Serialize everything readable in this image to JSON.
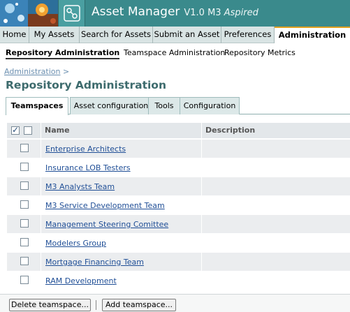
{
  "header": {
    "app_name": "Asset Manager",
    "version_prefix": "V1.0 M3",
    "version_suffix": "Aspired",
    "colors": {
      "bar": "#3a8a8c",
      "accent": "#e0a020"
    }
  },
  "main_nav": [
    {
      "label": "Home",
      "active": false
    },
    {
      "label": "My Assets",
      "active": false
    },
    {
      "label": "Search for Assets",
      "active": false
    },
    {
      "label": "Submit an Asset",
      "active": false
    },
    {
      "label": "Preferences",
      "active": false
    },
    {
      "label": "Administration",
      "active": true
    }
  ],
  "sub_nav": [
    {
      "label": "Repository Administration",
      "active": true
    },
    {
      "label": "Teamspace Administration",
      "active": false
    },
    {
      "label": "Repository Metrics",
      "active": false
    }
  ],
  "breadcrumb": {
    "link": "Administration",
    "separator": ">"
  },
  "page_title": "Repository Administration",
  "tabs": [
    {
      "label": "Teamspaces",
      "active": true
    },
    {
      "label": "Asset configuration",
      "active": false
    },
    {
      "label": "Tools",
      "active": false
    },
    {
      "label": "Configuration",
      "active": false
    }
  ],
  "table": {
    "columns": [
      "Name",
      "Description"
    ],
    "header_checkbox_checked": true,
    "rows": [
      {
        "name": "Enterprise Architects",
        "description": ""
      },
      {
        "name": "Insurance LOB Testers",
        "description": ""
      },
      {
        "name": "M3 Analysts Team",
        "description": ""
      },
      {
        "name": "M3 Service Development Team",
        "description": ""
      },
      {
        "name": "Management Steering Comittee",
        "description": ""
      },
      {
        "name": "Modelers Group",
        "description": ""
      },
      {
        "name": "Mortgage Financing Team",
        "description": ""
      },
      {
        "name": "RAM Development",
        "description": ""
      }
    ]
  },
  "buttons": {
    "delete": "Delete teamspace...",
    "add": "Add teamspace..."
  }
}
